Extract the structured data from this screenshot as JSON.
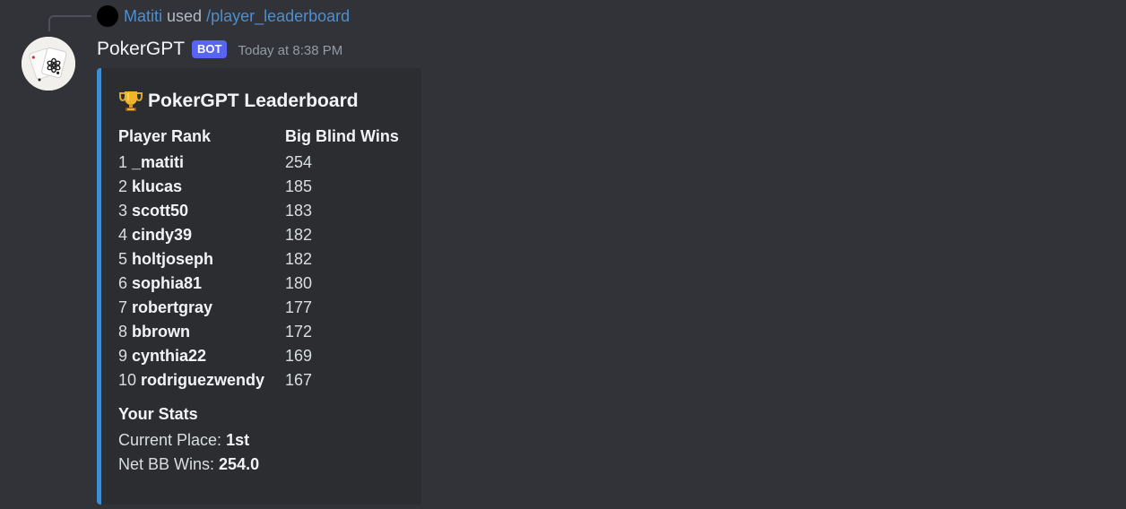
{
  "reply": {
    "user": "Matiti",
    "verb": "used",
    "command": "/player_leaderboard"
  },
  "message": {
    "author": "PokerGPT",
    "bot_tag": "BOT",
    "timestamp": "Today at 8:38 PM"
  },
  "embed": {
    "accent_color": "#3f8fd0",
    "title_icon": "trophy-icon",
    "title": "PokerGPT Leaderboard",
    "rank_header": "Player Rank",
    "wins_header": "Big Blind Wins",
    "rows": [
      {
        "rank": "1",
        "name": "_matiti",
        "wins": "254"
      },
      {
        "rank": "2",
        "name": "klucas",
        "wins": "185"
      },
      {
        "rank": "3",
        "name": "scott50",
        "wins": "183"
      },
      {
        "rank": "4",
        "name": "cindy39",
        "wins": "182"
      },
      {
        "rank": "5",
        "name": "holtjoseph",
        "wins": "182"
      },
      {
        "rank": "6",
        "name": "sophia81",
        "wins": "180"
      },
      {
        "rank": "7",
        "name": "robertgray",
        "wins": "177"
      },
      {
        "rank": "8",
        "name": "bbrown",
        "wins": "172"
      },
      {
        "rank": "9",
        "name": "cynthia22",
        "wins": "169"
      },
      {
        "rank": "10",
        "name": "rodriguezwendy",
        "wins": "167"
      }
    ],
    "stats": {
      "title": "Your Stats",
      "place_label": "Current Place:",
      "place_value": "1st",
      "net_label": "Net BB Wins:",
      "net_value": "254.0"
    }
  }
}
